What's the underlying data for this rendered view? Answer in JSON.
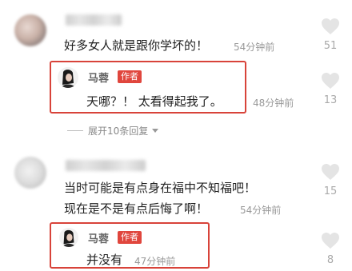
{
  "comments": [
    {
      "text": "好多女人就是跟你学坏的！",
      "time": "54分钟前",
      "likes": "51",
      "reply": {
        "author": "马蓉",
        "badge": "作者",
        "text": "天哪？！ 太看得起我了。",
        "time": "48分钟前",
        "likes": "13"
      },
      "expand": "展开10条回复"
    },
    {
      "text_line1": "当时可能是有点身在福中不知福吧！",
      "text_line2": "现在是不是有点后悔了啊！",
      "time": "54分钟前",
      "likes": "15",
      "reply": {
        "author": "马蓉",
        "badge": "作者",
        "text": "并没有",
        "time": "47分钟前",
        "likes": "8"
      }
    }
  ],
  "colors": {
    "highlight": "#d8433a",
    "badge": "#e0463d",
    "heart": "#e4e4e4"
  },
  "icons": [
    "heart-icon",
    "chevron-down-icon"
  ]
}
